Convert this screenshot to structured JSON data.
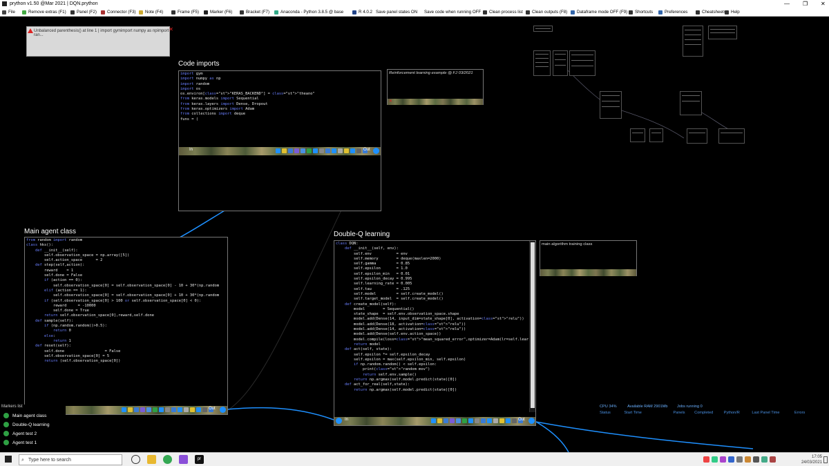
{
  "window": {
    "title": "prython v1.50 @Mar 2021 | DQN.prython",
    "controls": [
      "—",
      "❐",
      "✕"
    ]
  },
  "toolbar": [
    {
      "label": "File",
      "icon": "file-icon",
      "color": "#444"
    },
    {
      "label": "Remove extras  (F1)",
      "icon": "remove-extras-icon",
      "color": "#4a4"
    },
    {
      "label": "Panel  (F2)",
      "icon": "panel-icon",
      "color": "#333"
    },
    {
      "label": "Connector  (F3)",
      "icon": "connector-icon",
      "color": "#a33"
    },
    {
      "label": "Note  (F4)",
      "icon": "note-icon",
      "color": "#ca3"
    },
    {
      "label": "Frame  (F5)",
      "icon": "frame-icon",
      "color": "#333"
    },
    {
      "label": "Marker  (F6)",
      "icon": "marker-icon",
      "color": "#222"
    },
    {
      "label": "Bracket  (F7)",
      "icon": "bracket-icon",
      "color": "#333"
    },
    {
      "label": "Anaconda - Python 3.8.5 @ base",
      "icon": "anaconda-icon",
      "color": "#3a8"
    },
    {
      "label": "R 4.0.2",
      "icon": "r-icon",
      "color": "#248"
    },
    {
      "label": "Save panel states ON",
      "icon": "",
      "color": ""
    },
    {
      "label": "Save code when running OFF",
      "icon": "",
      "color": ""
    },
    {
      "label": "Clean process list",
      "icon": "clean-process-icon",
      "color": "#333"
    },
    {
      "label": "Clean outputs  (F8)",
      "icon": "clean-outputs-icon",
      "color": "#333"
    },
    {
      "label": "Dataframe mode OFF  (F9)",
      "icon": "dataframe-icon",
      "color": "#36a"
    },
    {
      "label": "Shortcuts",
      "icon": "shortcuts-icon",
      "color": "#333"
    },
    {
      "label": "Preferences",
      "icon": "preferences-icon",
      "color": "#36a"
    },
    {
      "label": "Cheatsheets",
      "icon": "cheatsheets-icon",
      "color": "#333"
    },
    {
      "label": "Help",
      "icon": "help-icon",
      "color": "#333"
    }
  ],
  "error": {
    "text": "Unbalanced parenthesis()  at line 1 | import gymimport numpy as npimport ran..."
  },
  "panels": {
    "imports": {
      "title": "Code imports",
      "in_label": "In",
      "out_label": "Out",
      "lines": [
        "import gym",
        "import numpy as np",
        "import random",
        "import os",
        "os.environ[\"KERAS_BACKEND\"] = \"theano\"",
        "from keras.models import Sequential",
        "from keras.layers import Dense, Dropout",
        "from keras.optimizers import Adam",
        "from collections import deque",
        "",
        "funs = ("
      ]
    },
    "agent": {
      "title": "Main agent class",
      "out_label": "Out",
      "lines": [
        "from random import random",
        "",
        "",
        "class hks():",
        "",
        "    def __init__(self):",
        "        self.observation_space = np.array([5])",
        "        self.action_space      = 2",
        "",
        "    def step(self,action):",
        "        reward    = 1",
        "        self.done = False",
        "        if (action == 0):",
        "            self.observation_space[0] = self.observation_space[0] - 10 + 30*(np.random",
        "        elif (action == 1):",
        "            self.observation_space[0] = self.observation_space[0] + 10 + 30*(np.random",
        "        if (self.observation_space[0] > 100 or self.observation_space[0] < 0):",
        "            reward     = -10000",
        "            self.done = True",
        "        return self.observation_space[0],reward,self.done",
        "",
        "    def sample(self):",
        "        if (np.random.random()>0.5):",
        "            return 0",
        "        else:",
        "            return 1",
        "",
        "    def reset(self):",
        "        self.done                  = False",
        "        self.observation_space[0] = 5",
        "        return (self.observation_space[0])"
      ]
    },
    "dqn": {
      "title": "Double-Q learning",
      "in_label": "In",
      "out_label": "Out",
      "lines": [
        "class DQN:",
        "    def __init__(self, env):",
        "        self.env           = env",
        "        self.memory        = deque(maxlen=2000)",
        "        self.gamma         = 0.85",
        "        self.epsilon       = 1.0",
        "        self.epsilon_min   = 0.01",
        "        self.epsilon_decay = 0.995",
        "        self.learning_rate = 0.005",
        "        self.tau           = .125",
        "        self.model         = self.create_model()",
        "        self.target_model  = self.create_model()",
        "",
        "    def create_model(self):",
        "        model        = Sequential()",
        "        state_shape  = self.env.observation_space.shape",
        "        model.add(Dense(14, input_dim=state_shape[0], activation=\"relu\"))",
        "        model.add(Dense(18, activation=\"relu\"))",
        "        model.add(Dense(14, activation=\"relu\"))",
        "        model.add(Dense(self.env.action_space))",
        "        model.compile(loss=\"mean_squared_error\",optimizer=Adam(lr=self.learning_rat",
        "        return model",
        "",
        "    def act(self, state):",
        "        self.epsilon *= self.epsilon_decay",
        "        self.epsilon = max(self.epsilon_min, self.epsilon)",
        "        if np.random.random() < self.epsilon:",
        "            print(\"random mov\")",
        "            return self.env.sample()",
        "        return np.argmax(self.model.predict(state)[0])",
        "",
        "    def act_for_real(self,state):",
        "        return np.argmax(self.model.predict(state)[0])"
      ]
    }
  },
  "notes": {
    "rl_example": "Reinforcement learning example @ FJ 03/2021",
    "training_class": "main algorithm training class"
  },
  "markers": {
    "header": "Markers list",
    "items": [
      "Main agent class",
      "Double-Q learning",
      "Agent test 2",
      "Agent test 1"
    ]
  },
  "status": {
    "cpu": "CPU  34%",
    "ram": "Available RAM  2901Mb",
    "jobs": "Jobs running  0",
    "columns": [
      "Status",
      "Start Time",
      "Panels",
      "Completed",
      "Python/R",
      "Last Panel Time",
      "Errors"
    ]
  },
  "taskbar": {
    "search_placeholder": "Type here to search",
    "time": "17:05",
    "date": "24/03/2021",
    "pinned_label": "pr"
  },
  "colors": {
    "connector": "#1e90ff",
    "marker_dot": "#2ea043",
    "error_red": "#d22"
  }
}
